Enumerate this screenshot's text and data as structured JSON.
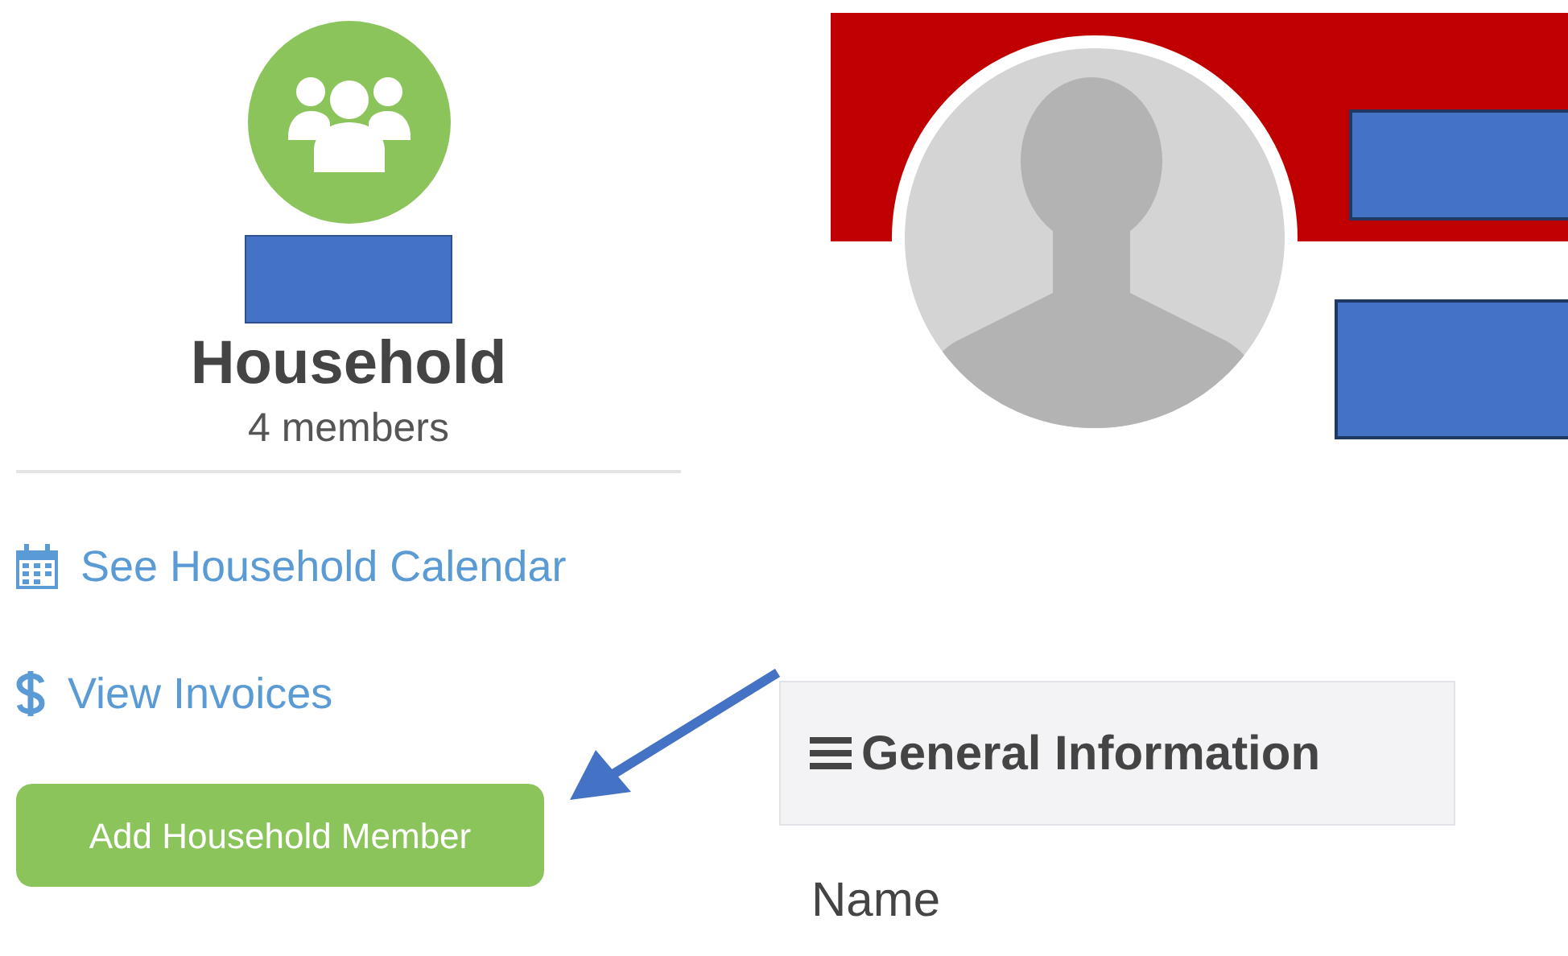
{
  "household": {
    "title": "Household",
    "members": "4 members",
    "links": [
      {
        "kind": "calendar",
        "label": "See Household Calendar"
      },
      {
        "kind": "dollar",
        "label": "View Invoices"
      }
    ],
    "button": "Add Household Member"
  },
  "section": {
    "title": "General Information"
  },
  "fields": [
    {
      "label": "Name"
    }
  ]
}
